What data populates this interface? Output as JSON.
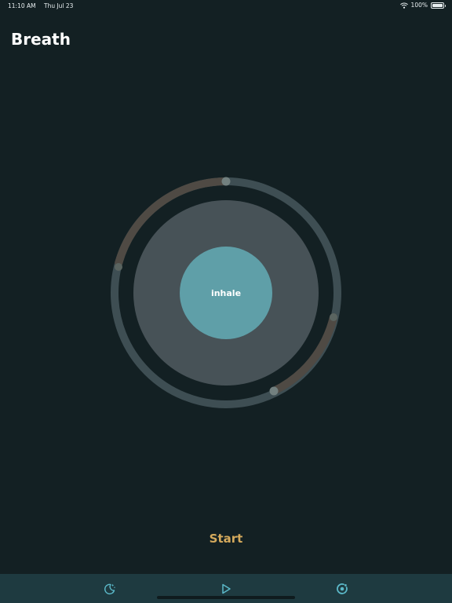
{
  "status_bar": {
    "time": "11:10 AM",
    "date": "Thu Jul 23",
    "battery": "100%",
    "wifi_icon": "wifi-icon",
    "battery_icon": "battery-icon"
  },
  "header": {
    "title": "Breath"
  },
  "breath": {
    "phase_label": "inhale"
  },
  "controls": {
    "start_label": "Start"
  },
  "tab_bar": {
    "tabs": [
      {
        "icon": "moon-icon"
      },
      {
        "icon": "play-icon"
      },
      {
        "icon": "focus-icon"
      }
    ]
  },
  "colors": {
    "background": "#132023",
    "track": "#3e4e53",
    "progress": "#4f4a44",
    "outer_disc": "#475257",
    "inner_circle": "#5f9fa8",
    "accent": "#d4a95c",
    "tab_bar": "#1e3a40",
    "tab_icon": "#5bb8c8"
  }
}
